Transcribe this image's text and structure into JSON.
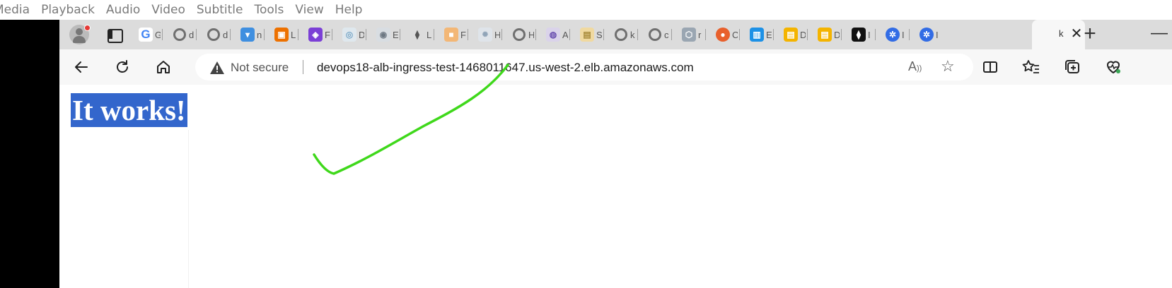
{
  "menubar": {
    "items": [
      "Media",
      "Playback",
      "Audio",
      "Video",
      "Subtitle",
      "Tools",
      "View",
      "Help"
    ]
  },
  "browser": {
    "tabs": [
      {
        "icon": "google-icon",
        "title": "G"
      },
      {
        "icon": "github-icon",
        "title": "d"
      },
      {
        "icon": "github-icon",
        "title": "d"
      },
      {
        "icon": "aws-s3-icon",
        "title": "n"
      },
      {
        "icon": "aws-ec2-icon",
        "title": "L"
      },
      {
        "icon": "aws-cognito-icon",
        "title": "F"
      },
      {
        "icon": "aws-eks-icon",
        "title": "D"
      },
      {
        "icon": "docker-icon",
        "title": "E"
      },
      {
        "icon": "terraform-icon",
        "title": "L"
      },
      {
        "icon": "package-icon",
        "title": "F"
      },
      {
        "icon": "helm-icon",
        "title": "H"
      },
      {
        "icon": "github-icon",
        "title": "H"
      },
      {
        "icon": "cloud-icon",
        "title": "A"
      },
      {
        "icon": "docs-icon",
        "title": "S"
      },
      {
        "icon": "github-icon",
        "title": "k"
      },
      {
        "icon": "github-icon",
        "title": "c"
      },
      {
        "icon": "hexagon-icon",
        "title": "r"
      },
      {
        "icon": "firefox-icon",
        "title": "C"
      },
      {
        "icon": "docker-icon",
        "title": "E"
      },
      {
        "icon": "docs-icon",
        "title": "D"
      },
      {
        "icon": "docs-icon",
        "title": "D"
      },
      {
        "icon": "terraform-icon",
        "title": "I"
      },
      {
        "icon": "kubernetes-icon",
        "title": "I"
      },
      {
        "icon": "kubernetes-icon",
        "title": "I"
      }
    ],
    "active_tab": {
      "icon": "github-icon",
      "title": "k",
      "close_glyph": "✕"
    },
    "new_tab_glyph": "+",
    "minimize_glyph": "—",
    "address": {
      "security_label": "Not secure",
      "url": "devops18-alb-ingress-test-1468011647.us-west-2.elb.amazonaws.com"
    }
  },
  "page": {
    "heading": "It works!"
  },
  "annotation": {
    "color": "#3fd81b",
    "shape": "checkmark"
  },
  "colors": {
    "heading_bg": "#3366cc",
    "heading_fg": "#ffffff",
    "tabstrip": "#dcdcdc",
    "toolbar": "#f7f7f7"
  }
}
